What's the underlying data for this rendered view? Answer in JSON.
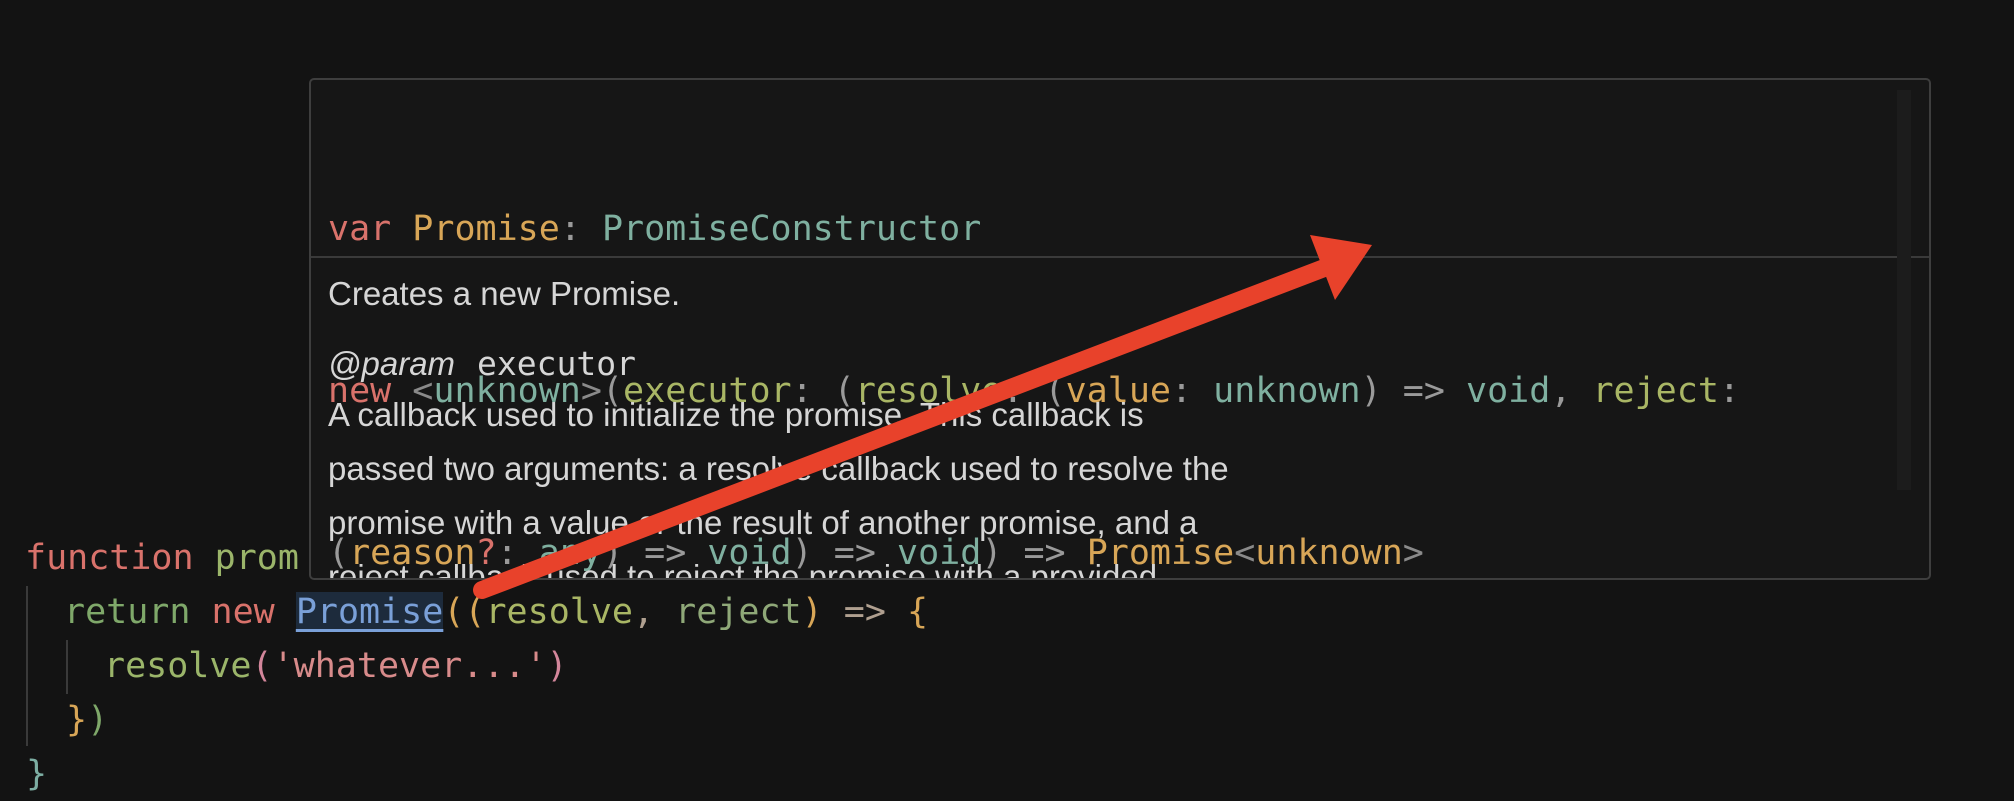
{
  "hover": {
    "signature": {
      "line1": {
        "kw": "var",
        "name": "Promise",
        "colon": ":",
        "type": "PromiseConstructor"
      },
      "line2": {
        "new": "new",
        "lt": "<",
        "generic": "unknown",
        "gt": ">",
        "open": "(",
        "executor": "executor",
        "c1": ":",
        "open2": "(",
        "resolve": "resolve",
        "c2": ":",
        "open3": "(",
        "value": "value",
        "c3": ":",
        "unknown1": "unknown",
        "close3": ")",
        "arrow1": " => ",
        "void1": "void",
        "comma1": ",",
        "reject": "reject",
        "c4": ":"
      },
      "line3": {
        "open4": "(",
        "reason": "reason",
        "q": "?",
        "c5": ":",
        "any": "any",
        "close4": ")",
        "arrow2": " => ",
        "void2": "void",
        "close5": ")",
        "arrow3": " => ",
        "void3": "void",
        "close6": ")",
        "arrow4": " => ",
        "ret": "Promise",
        "lt2": "<",
        "unknown2": "unknown",
        "gt2": ">"
      }
    },
    "doc": {
      "summary": "Creates a new Promise.",
      "param_tag": "@param",
      "param_name": "executor",
      "lines": [
        "A callback used to initialize the promise. This callback is",
        "passed two arguments: a resolve callback used to resolve the",
        "promise with a value or the result of another promise, and a",
        "reject callback used to reject the promise with a provided"
      ]
    }
  },
  "code": {
    "line1": {
      "kw": "function",
      "name": "prom"
    },
    "line2": {
      "ret": "return",
      "new": "new",
      "promise": "Promise",
      "open": "(",
      "open2": "(",
      "resolve": "resolve",
      "comma": ",",
      "reject": "reject",
      "close2": ")",
      "arrow": " => ",
      "brace": "{"
    },
    "line3": {
      "fn": "resolve",
      "open": "(",
      "str": "'whatever...'",
      "close": ")"
    },
    "line4": {
      "brace": "}",
      "paren": ")"
    },
    "line5": {
      "brace": "}"
    }
  },
  "annotation": {
    "color": "#e8422b"
  }
}
